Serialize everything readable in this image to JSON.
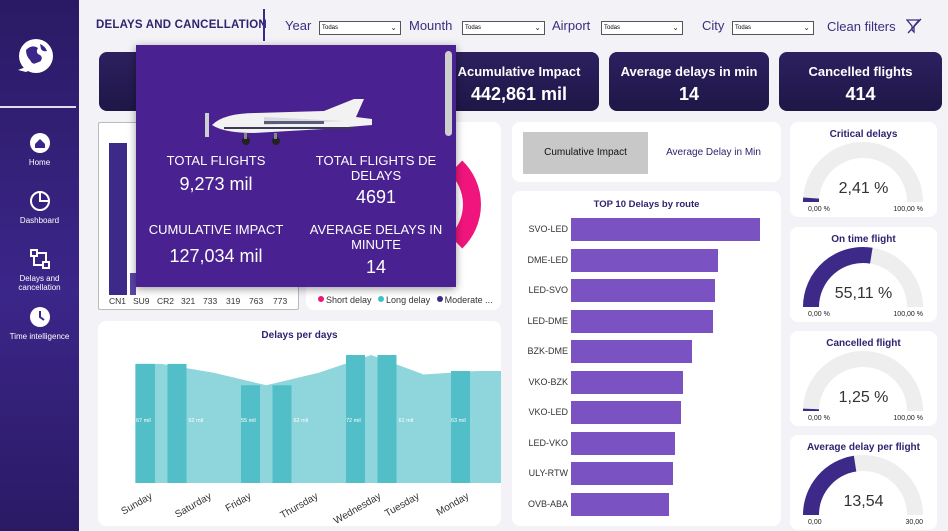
{
  "sidebar": {
    "items": [
      {
        "label": "Home",
        "icon": "home-icon"
      },
      {
        "label": "Dashboard",
        "icon": "dashboard-icon"
      },
      {
        "label": "Delays and cancellation",
        "icon": "flow-icon"
      },
      {
        "label": "Time intelligence",
        "icon": "clock-icon"
      }
    ]
  },
  "header": {
    "title": "DELAYS AND CANCELLATION",
    "filters": [
      {
        "label": "Year",
        "value": "Todas"
      },
      {
        "label": "Mounth",
        "value": "Todas"
      },
      {
        "label": "Airport",
        "value": "Todas"
      },
      {
        "label": "City",
        "value": "Todas"
      }
    ],
    "clean_filters": "Clean filters"
  },
  "kpis": [
    {
      "label": "Acumulative Impact",
      "value": "442,861 mil"
    },
    {
      "label": "Average delays in min",
      "value": "14"
    },
    {
      "label": "Cancelled flights",
      "value": "414"
    }
  ],
  "tooltip": {
    "total_flights_label": "TOTAL FLIGHTS",
    "total_flights_value": "9,273 mil",
    "total_delays_label": "TOTAL FLIGHTS DE DELAYS",
    "total_delays_value": "4691",
    "cumulative_label": "CUMULATIVE IMPACT",
    "cumulative_value": "127,034 mil",
    "avg_label": "AVERAGE DELAYS IN MINUTE",
    "avg_value": "14"
  },
  "left_chart": {
    "x_labels": [
      "CN1",
      "SU9",
      "CR2",
      "321",
      "733",
      "319",
      "763",
      "773"
    ]
  },
  "donut_legend": [
    {
      "label": "Short delay",
      "color": "#f0157d"
    },
    {
      "label": "Long delay",
      "color": "#3fc0c9"
    },
    {
      "label": "Moderate ...",
      "color": "#3d2a88"
    }
  ],
  "tabs": {
    "cumulative": "Cumulative Impact",
    "average": "Average Delay in Min"
  },
  "chart_data": [
    {
      "type": "area",
      "title": "Delays per days",
      "categories": [
        "Sunday",
        "Saturday",
        "Friday",
        "Thursday",
        "Wednesday",
        "Tuesday",
        "Monday"
      ],
      "values": [
        0.67,
        0.62,
        0.55,
        0.62,
        0.72,
        0.61,
        0.63
      ],
      "data_labels": [
        "67 mil",
        "62 mil",
        "55 mil",
        "62 mil",
        "72 mil",
        "61 mil",
        "63 mil"
      ]
    },
    {
      "type": "bar",
      "title": "TOP 10 Delays by route",
      "categories": [
        "SVO-LED",
        "DME-LED",
        "LED-SVO",
        "LED-DME",
        "BZK-DME",
        "VKO-BZK",
        "VKO-LED",
        "LED-VKO",
        "ULY-RTW",
        "OVB-ABA"
      ],
      "values": [
        100,
        78,
        76,
        75,
        64,
        59,
        58,
        55,
        54,
        52
      ]
    }
  ],
  "gauges": [
    {
      "title": "Critical delays",
      "value": "2,41 %",
      "fraction": 0.0241,
      "min": "0,00 %",
      "max": "100,00 %"
    },
    {
      "title": "On time flight",
      "value": "55,11 %",
      "fraction": 0.5511,
      "min": "0,00 %",
      "max": "100,00 %"
    },
    {
      "title": "Cancelled flight",
      "value": "1,25 %",
      "fraction": 0.0125,
      "min": "0,00 %",
      "max": "100,00 %"
    },
    {
      "title": "Average delay per flight",
      "value": "13,54",
      "fraction": 0.4513,
      "min": "0,00",
      "max": "30,00"
    }
  ],
  "colors": {
    "accent": "#3d2a88",
    "teal": "#5fc3cd",
    "purple_bar": "#7a52c2",
    "pink": "#f0157d"
  }
}
